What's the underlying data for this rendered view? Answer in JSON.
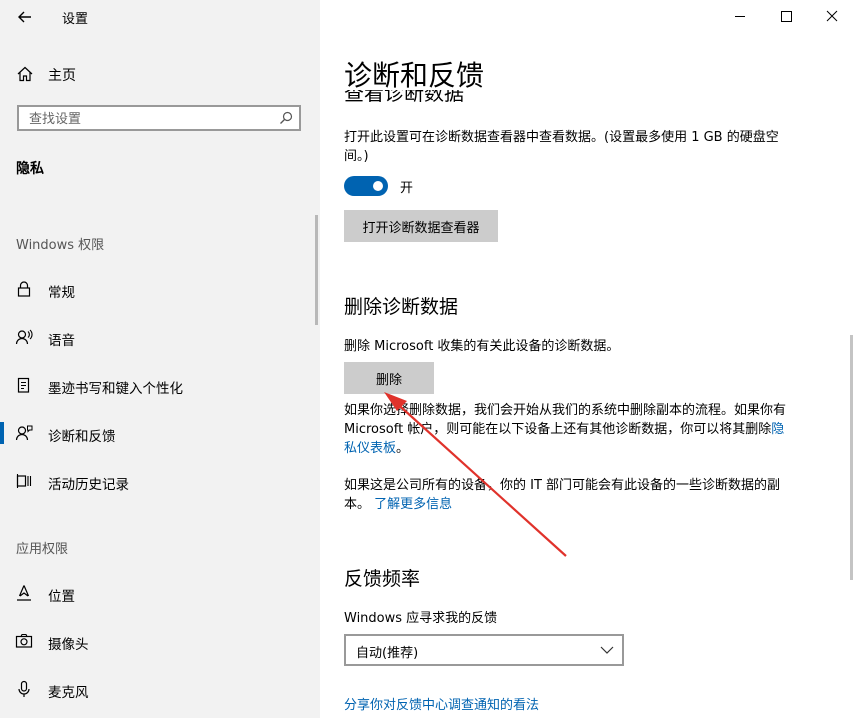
{
  "app": {
    "title": "设置"
  },
  "sidebar": {
    "home_label": "主页",
    "search_placeholder": "查找设置",
    "category": "隐私",
    "sections": [
      {
        "header": "Windows 权限",
        "items": [
          {
            "label": "常规",
            "icon": "lock-icon"
          },
          {
            "label": "语音",
            "icon": "speech-icon"
          },
          {
            "label": "墨迹书写和键入个性化",
            "icon": "pen-clipboard-icon"
          },
          {
            "label": "诊断和反馈",
            "icon": "feedback-person-icon",
            "selected": true
          },
          {
            "label": "活动历史记录",
            "icon": "timeline-icon"
          }
        ]
      },
      {
        "header": "应用权限",
        "items": [
          {
            "label": "位置",
            "icon": "location-icon"
          },
          {
            "label": "摄像头",
            "icon": "camera-icon"
          },
          {
            "label": "麦克风",
            "icon": "microphone-icon"
          }
        ]
      }
    ]
  },
  "main": {
    "title": "诊断和反馈",
    "view_data": {
      "title_clipped": "查看诊断数据",
      "description": "打开此设置可在诊断数据查看器中查看数据。(设置最多使用 1 GB 的硬盘空间。)",
      "toggle_state": "开",
      "toggle_on": true,
      "button_label": "打开诊断数据查看器"
    },
    "delete_data": {
      "title": "删除诊断数据",
      "description": "删除 Microsoft 收集的有关此设备的诊断数据。",
      "button_label": "删除",
      "info_text": "如果你选择删除数据，我们会开始从我们的系统中删除副本的流程。如果你有 Microsoft 帐户，则可能在以下设备上还有其他诊断数据，你可以将其删除",
      "privacy_link": "隐私仪表板",
      "info_end": "。",
      "company_text": "如果这是公司所有的设备，你的 IT 部门可能会有此设备的一些诊断数据的副本。",
      "learn_more_link": "了解更多信息"
    },
    "feedback": {
      "title": "反馈频率",
      "label": "Windows 应寻求我的反馈",
      "dropdown_value": "自动(推荐)",
      "share_link": "分享你对反馈中心调查通知的看法"
    }
  },
  "colors": {
    "accent": "#0063b1",
    "sidebar_bg": "#f2f2f2",
    "button_bg": "#cccccc",
    "annotation_arrow": "#e0322b"
  }
}
